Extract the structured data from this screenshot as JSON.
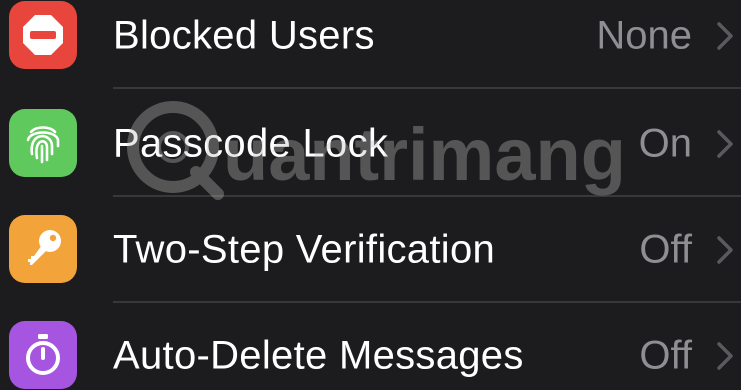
{
  "settings": {
    "rows": [
      {
        "label": "Blocked Users",
        "value": "None",
        "icon": "stop-icon",
        "icon_color": "#e8453c"
      },
      {
        "label": "Passcode Lock",
        "value": "On",
        "icon": "fingerprint-icon",
        "icon_color": "#5fc95d"
      },
      {
        "label": "Two-Step Verification",
        "value": "Off",
        "icon": "key-icon",
        "icon_color": "#f2a33a"
      },
      {
        "label": "Auto-Delete Messages",
        "value": "Off",
        "icon": "timer-icon",
        "icon_color": "#a555e0"
      }
    ]
  },
  "watermark": {
    "text": "uantrimang"
  },
  "colors": {
    "background": "#1c1c1e",
    "label": "#ffffff",
    "value": "#8e8e93",
    "separator": "#38383a"
  }
}
